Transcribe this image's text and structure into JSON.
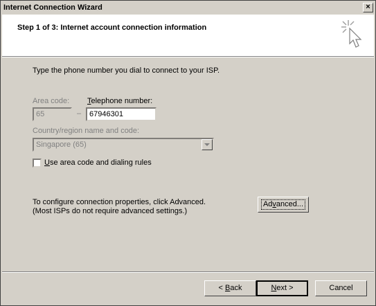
{
  "window": {
    "title": "Internet Connection Wizard",
    "close_label": "×"
  },
  "header": {
    "step_title": "Step 1 of 3: Internet account connection information"
  },
  "form": {
    "instruction": "Type the phone number you dial to connect to your ISP.",
    "area_code_label": "Area code:",
    "area_code_value": "65",
    "dash": "–",
    "telephone_label_first": "T",
    "telephone_label_rest": "elephone number:",
    "telephone_value": "67946301",
    "country_label": "Country/region name and code:",
    "country_value": "Singapore (65)",
    "checkbox_label_first": "U",
    "checkbox_label_rest": "se area code and dialing rules",
    "checkbox_checked": false
  },
  "advanced": {
    "line1": "To configure connection properties, click Advanced.",
    "line2": "(Most ISPs do not require advanced settings.)",
    "button_first": "Ad",
    "button_u": "v",
    "button_rest": "anced..."
  },
  "footer": {
    "back_prefix": "< ",
    "back_u": "B",
    "back_rest": "ack",
    "next_u": "N",
    "next_rest": "ext >",
    "cancel_label": "Cancel"
  }
}
